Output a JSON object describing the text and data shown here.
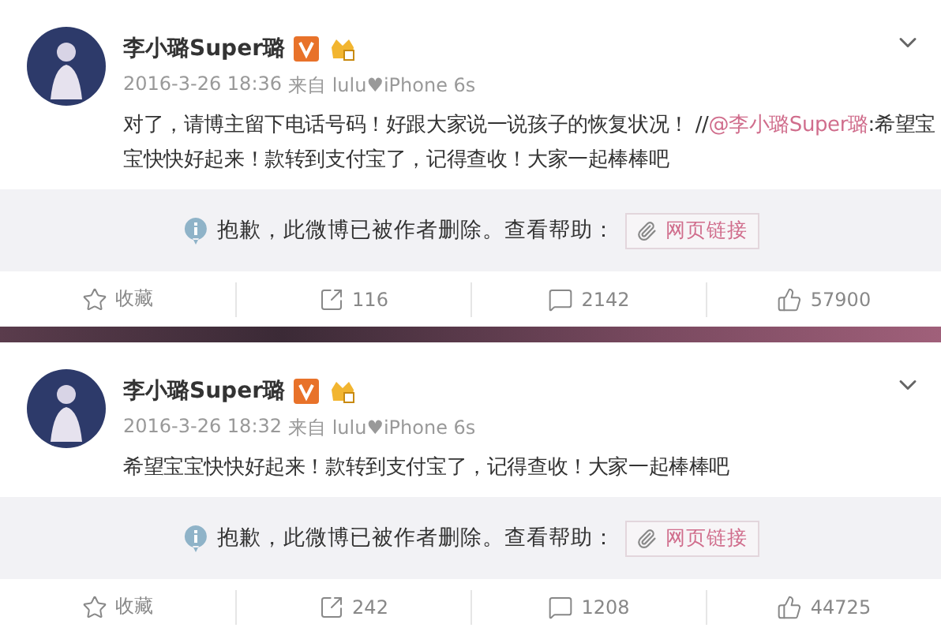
{
  "posts": [
    {
      "author": "李小璐Super璐",
      "time": "2016-3-26 18:36",
      "source": "来自 lulu♥iPhone 6s",
      "content": [
        {
          "kind": "plain",
          "text": "对了，请博主留下电话号码！好跟大家说一说孩子的恢复状况！ //"
        },
        {
          "kind": "mention",
          "text": "@李小璐Super璐"
        },
        {
          "kind": "plain",
          "text": ":希望宝宝快快好起来！款转到支付宝了，记得查收！大家一起棒棒吧"
        }
      ],
      "notice": {
        "message": "抱歉，此微博已被作者删除。查看帮助：",
        "link": "网页链接"
      },
      "actions": [
        {
          "kind": "favorite",
          "label": "收藏"
        },
        {
          "kind": "repost",
          "label": "116"
        },
        {
          "kind": "comment",
          "label": "2142"
        },
        {
          "kind": "like",
          "label": "57900"
        }
      ]
    },
    {
      "author": "李小璐Super璐",
      "time": "2016-3-26 18:32",
      "source": "来自 lulu♥iPhone 6s",
      "content": [
        {
          "kind": "plain",
          "text": "希望宝宝快快好起来！款转到支付宝了，记得查收！大家一起棒棒吧"
        }
      ],
      "notice": {
        "message": "抱歉，此微博已被作者删除。查看帮助：",
        "link": "网页链接"
      },
      "actions": [
        {
          "kind": "favorite",
          "label": "收藏"
        },
        {
          "kind": "repost",
          "label": "242"
        },
        {
          "kind": "comment",
          "label": "1208"
        },
        {
          "kind": "like",
          "label": "44725"
        }
      ]
    }
  ]
}
